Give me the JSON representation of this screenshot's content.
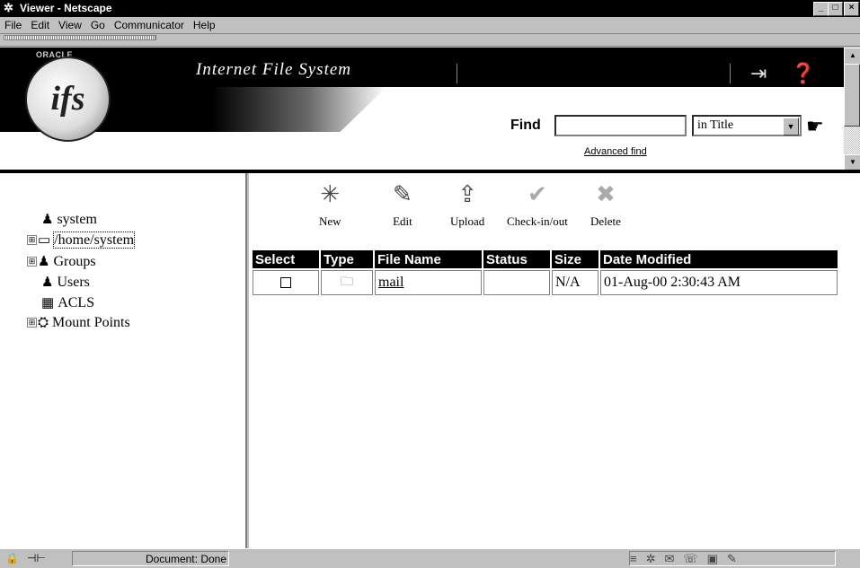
{
  "window": {
    "title": "Viewer - Netscape"
  },
  "menu": [
    "File",
    "Edit",
    "View",
    "Go",
    "Communicator",
    "Help"
  ],
  "banner": {
    "vendor": "ORACLE",
    "logo_text": "ifs",
    "product_title": "Internet File System",
    "find_label": "Find",
    "find_value": "",
    "find_scope": "in Title",
    "advanced_find": "Advanced find"
  },
  "tree": {
    "items": [
      {
        "label": "system",
        "expander": ""
      },
      {
        "label": "/home/system",
        "expander": "⊞"
      },
      {
        "label": "Groups",
        "expander": "⊞"
      },
      {
        "label": "Users",
        "expander": ""
      },
      {
        "label": "ACLS",
        "expander": ""
      },
      {
        "label": "Mount Points",
        "expander": "⊞"
      }
    ]
  },
  "toolbar": {
    "new_label": "New",
    "edit_label": "Edit",
    "upload_label": "Upload",
    "checkin_label": "Check-in/out",
    "delete_label": "Delete"
  },
  "table": {
    "headers": [
      "Select",
      "Type",
      "File Name",
      "Status",
      "Size",
      "Date Modified"
    ],
    "rows": [
      {
        "select": false,
        "type": "folder",
        "name": "mail",
        "status": "",
        "size": "N/A",
        "date": "01-Aug-00 2:30:43 AM"
      }
    ]
  },
  "status": {
    "text": "Document: Done"
  }
}
